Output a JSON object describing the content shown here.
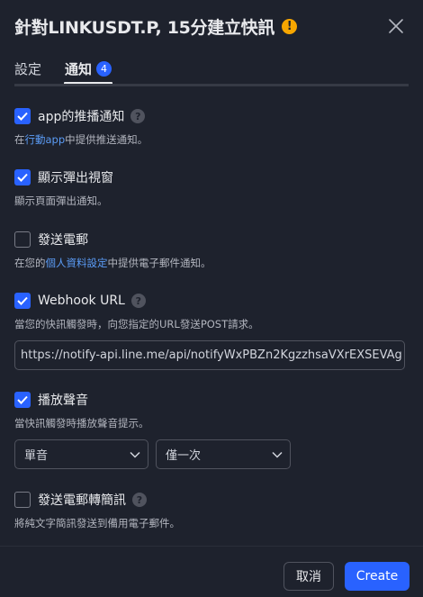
{
  "dialog": {
    "title": "針對LINKUSDT.P, 15分建立快訊",
    "warning_glyph": "!"
  },
  "tabs": [
    {
      "label": "設定",
      "active": false
    },
    {
      "label": "通知",
      "active": true,
      "badge": "4"
    }
  ],
  "options": {
    "app_push": {
      "checked": true,
      "label": "app的推播通知",
      "desc_prefix": "在",
      "desc_link": "行動app",
      "desc_suffix": "中提供推送通知。"
    },
    "popup": {
      "checked": true,
      "label": "顯示彈出視窗",
      "desc": "顯示頁面彈出通知。"
    },
    "email": {
      "checked": false,
      "label": "發送電郵",
      "desc_prefix": "在您的",
      "desc_link": "個人資料設定",
      "desc_suffix": "中提供電子郵件通知。"
    },
    "webhook": {
      "checked": true,
      "label": "Webhook URL",
      "desc": "當您的快訊觸發時，向您指定的URL發送POST請求。",
      "url_value": "https://notify-api.line.me/api/notifyWxPBZn2KgzzhsaVXrEXSEVAg"
    },
    "sound": {
      "checked": true,
      "label": "播放聲音",
      "desc": "當快訊觸發時播放聲音提示。",
      "sound_select": "單音",
      "repeat_select": "僅一次"
    },
    "email_sms": {
      "checked": false,
      "label": "發送電郵轉簡訊",
      "desc": "將純文字簡訊發送到備用電子郵件。"
    }
  },
  "footer": {
    "cancel_label": "取消",
    "create_label": "Create"
  },
  "colors": {
    "background": "#1e222d",
    "accent": "#2962ff",
    "warning": "#f7a600",
    "link": "#5b9cf6"
  },
  "help_glyph": "?"
}
